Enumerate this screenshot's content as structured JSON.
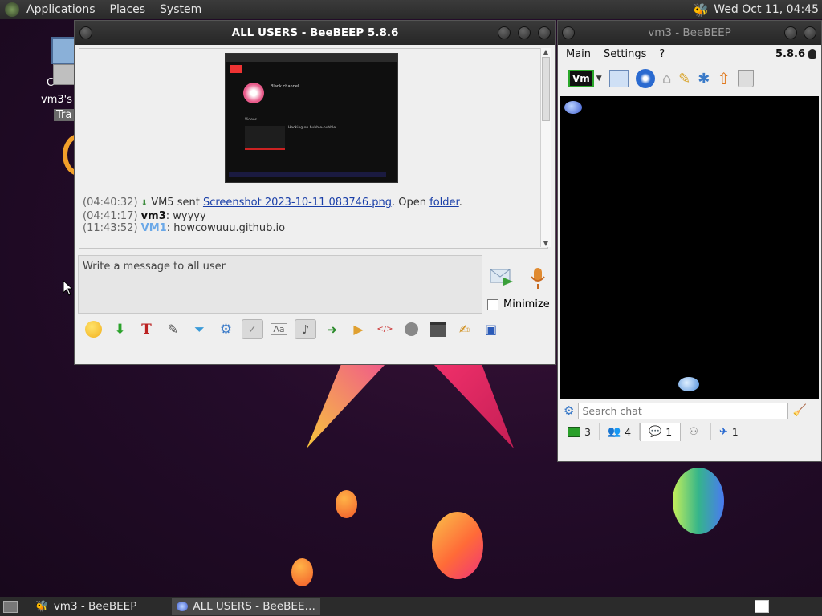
{
  "top_panel": {
    "menus": [
      "Applications",
      "Places",
      "System"
    ],
    "clock": "Wed Oct 11, 04:45"
  },
  "desktop_icons": {
    "home_label_partial": "vm3's h",
    "computer_label_partial": "C",
    "trash_label_partial": "Tra"
  },
  "main_window": {
    "title": "ALL USERS - BeeBEEP 5.8.6",
    "messages": [
      {
        "time": "(04:40:32)",
        "text": " VM5 sent ",
        "link": "Screenshot 2023-10-11 083746.png",
        "after": ". Open ",
        "link2": "folder",
        "end": "."
      },
      {
        "time": "(04:41:17)",
        "user": "vm3",
        "text": ": wyyyy"
      },
      {
        "time": "(11:43:52)",
        "user": "VM1",
        "text": ": howcowuuu.github.io"
      }
    ],
    "compose_placeholder": "Write a message to all user",
    "minimize_label": "Minimize",
    "preview": {
      "channel_name": "Blank channel",
      "tab_label": "Videos",
      "video_title": "Hacking on bubble-bubble"
    }
  },
  "side_window": {
    "title": "vm3 - BeeBEEP",
    "menus": [
      "Main",
      "Settings",
      "?"
    ],
    "version": "5.8.6",
    "status_icon_label": "Vm",
    "search_placeholder": "Search chat",
    "tabs": [
      {
        "icon": "computer-icon",
        "count": "3"
      },
      {
        "icon": "users-icon",
        "count": "4"
      },
      {
        "icon": "chat-icon",
        "count": "1"
      },
      {
        "icon": "groups-icon",
        "count": ""
      },
      {
        "icon": "share-icon",
        "count": "1"
      }
    ]
  },
  "taskbar": {
    "tasks": [
      {
        "label": "vm3 - BeeBEEP",
        "active": false
      },
      {
        "label": "ALL USERS - BeeBEE…",
        "active": true
      }
    ]
  },
  "colors": {
    "panel": "#2a2a2a",
    "link": "#1a3fa8",
    "vm1": "#6aa8e8"
  }
}
